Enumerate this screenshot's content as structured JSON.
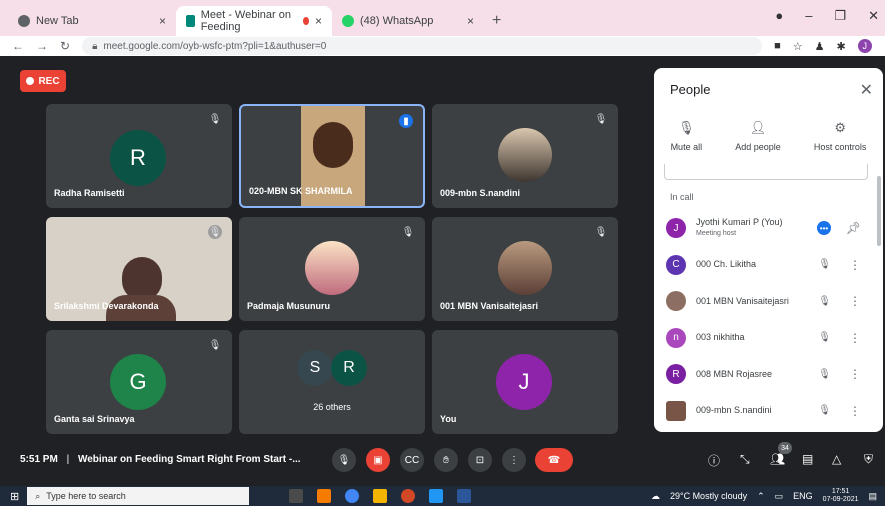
{
  "browser": {
    "tabs": [
      {
        "label": "New Tab",
        "close": "×"
      },
      {
        "label": "Meet - Webinar on Feeding",
        "close": "×"
      },
      {
        "label": "(48) WhatsApp",
        "close": "×"
      }
    ],
    "new_tab": "+",
    "url": "meet.google.com/oyb-wsfc-ptm?pli=1&authuser=0",
    "profile_initial": "J"
  },
  "meet": {
    "rec_label": "REC",
    "tiles": [
      {
        "name": "Radha Ramisetti",
        "initial": "R",
        "color": "#0b5345"
      },
      {
        "name": "020-MBN SK SHARMILA",
        "initial": ""
      },
      {
        "name": "009-mbn S.nandini",
        "initial": ""
      },
      {
        "name": "Srilakshmi Devarakonda",
        "initial": ""
      },
      {
        "name": "Padmaja Musunuru",
        "initial": ""
      },
      {
        "name": "001 MBN Vanisaitejasri",
        "initial": ""
      },
      {
        "name": "Ganta sai Srinavya",
        "initial": "G",
        "color": "#1e8449"
      },
      {
        "name": "26 others",
        "initials": [
          "S",
          "R"
        ]
      },
      {
        "name": "You",
        "initial": "J",
        "color": "#8e24aa"
      }
    ],
    "time": "5:51 PM",
    "separator": "|",
    "meeting_title": "Webinar on Feeding Smart Right From Start -...",
    "people_count": "34"
  },
  "people_panel": {
    "title": "People",
    "actions": [
      {
        "label": "Mute all",
        "icon": "mute-all-icon"
      },
      {
        "label": "Add people",
        "icon": "add-person-icon"
      },
      {
        "label": "Host controls",
        "icon": "host-controls-icon"
      }
    ],
    "in_call_label": "In call",
    "participants": [
      {
        "name": "Jyothi Kumari P (You)",
        "sub": "Meeting host",
        "initial": "J",
        "color": "#8e24aa"
      },
      {
        "name": "000 Ch. Likitha",
        "initial": "C",
        "color": "#5e35b1"
      },
      {
        "name": "001 MBN Vanisaitejasri",
        "initial": "",
        "color": "#8d6e63"
      },
      {
        "name": "003 nikhitha",
        "initial": "n",
        "color": "#ab47bc"
      },
      {
        "name": "008 MBN Rojasree",
        "initial": "R",
        "color": "#7b1fa2"
      },
      {
        "name": "009-mbn S.nandini",
        "initial": "",
        "color": "#795548"
      }
    ]
  },
  "taskbar": {
    "search_placeholder": "Type here to search",
    "weather": "29°C  Mostly cloudy",
    "lang": "ENG",
    "clock_time": "17:51",
    "clock_date": "07-09-2021"
  }
}
